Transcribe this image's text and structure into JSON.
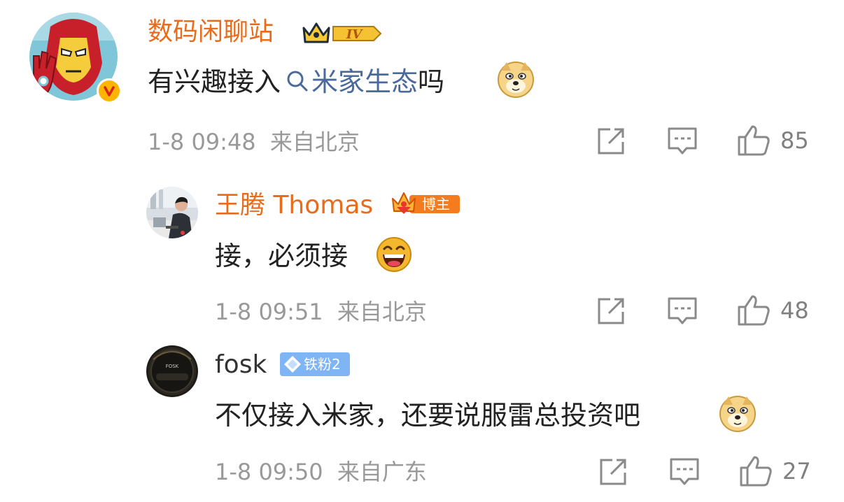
{
  "colors": {
    "username_orange": "#e86c1c",
    "username_dark": "#333333",
    "topic_blue": "#496a9a",
    "meta_gray": "#999999",
    "text_dark": "#222222"
  },
  "comments": [
    {
      "username": "数码闲聊站",
      "level_badge": "IV",
      "text_prefix": "有兴趣接入",
      "topic_label": "米家生态",
      "text_suffix": "吗",
      "emoji": "doge-emoji",
      "time": "1-8 09:48",
      "location": "来自北京",
      "likes": "85"
    },
    {
      "username": "王腾 Thomas",
      "role_badge": "博主",
      "text": "接，必须接",
      "emoji": "laugh-emoji",
      "time": "1-8 09:51",
      "location": "来自北京",
      "likes": "48"
    },
    {
      "username": "fosk",
      "fan_badge": "铁粉2",
      "avatar_text": "FOSK",
      "text": "不仅接入米家，还要说服雷总投资吧",
      "emoji": "doge-emoji",
      "time": "1-8 09:50",
      "location": "来自广东",
      "likes": "27"
    }
  ]
}
